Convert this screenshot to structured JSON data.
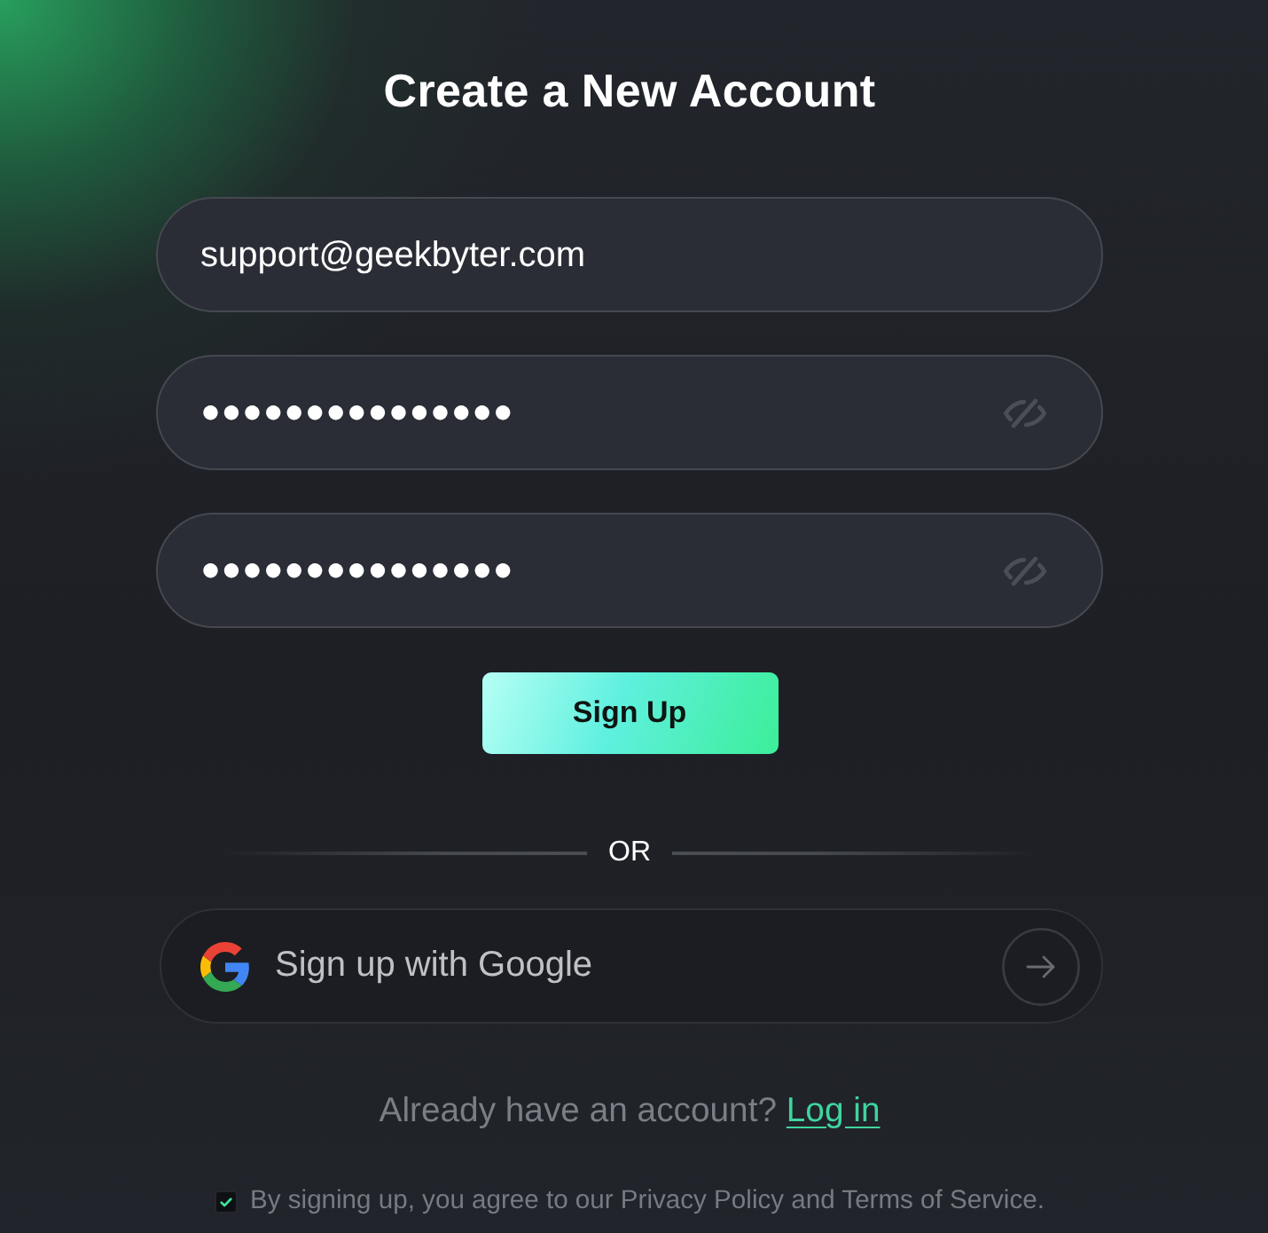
{
  "title": "Create a New Account",
  "fields": [
    {
      "kind": "email",
      "value": "support@geekbyter.com"
    },
    {
      "kind": "password",
      "value": "●●●●●●●●●●●●●●●",
      "revealed": false
    },
    {
      "kind": "password",
      "value": "●●●●●●●●●●●●●●●",
      "revealed": false
    }
  ],
  "submit": {
    "label": "Sign Up"
  },
  "divider": {
    "label": "OR"
  },
  "google_button": {
    "label": "Sign up with Google"
  },
  "login_prompt": {
    "text": "Already have an account?",
    "link": "Log in"
  },
  "agreement": {
    "checked": true,
    "text": "By signing up, you agree to our Privacy Policy and Terms of Service."
  }
}
